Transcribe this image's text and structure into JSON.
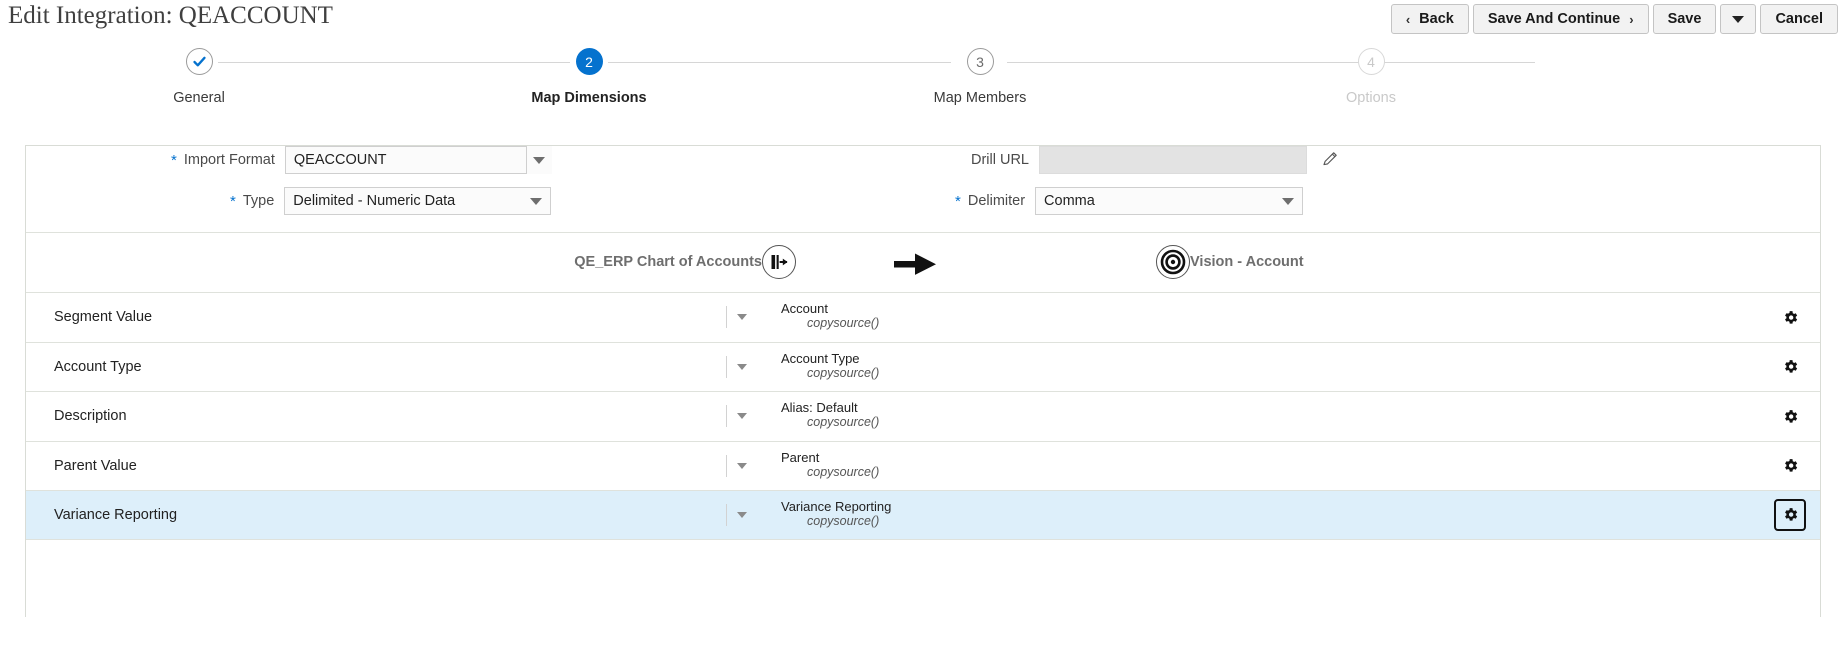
{
  "header": {
    "title": "Edit Integration: QEACCOUNT",
    "buttons": [
      {
        "name": "back",
        "label": "Back",
        "icon": "chevron-left-icon"
      },
      {
        "name": "save-and-continue",
        "label": "Save And Continue",
        "icon": "chevron-right-icon"
      },
      {
        "name": "save",
        "label": "Save",
        "icon": ""
      },
      {
        "name": "save-menu",
        "label": "",
        "icon": "caret-down-icon"
      },
      {
        "name": "cancel",
        "label": "Cancel",
        "icon": ""
      }
    ]
  },
  "train": {
    "steps": [
      {
        "number": "",
        "label": "General",
        "state": "done",
        "icon": "check-icon"
      },
      {
        "number": "2",
        "label": "Map Dimensions",
        "state": "current"
      },
      {
        "number": "3",
        "label": "Map Members",
        "state": "todo"
      },
      {
        "number": "4",
        "label": "Options",
        "state": "disabled"
      }
    ]
  },
  "form": {
    "import_format": {
      "label": "Import Format",
      "required": "*",
      "value": "QEACCOUNT",
      "placeholder": ""
    },
    "type": {
      "label": "Type",
      "required": "*",
      "value": "Delimited - Numeric Data",
      "placeholder": ""
    },
    "drill_url": {
      "label": "Drill URL",
      "required": "",
      "value": "",
      "placeholder": "",
      "edit_icon": "pencil-icon"
    },
    "delimiter": {
      "label": "Delimiter",
      "required": "*",
      "value": "Comma",
      "placeholder": ""
    }
  },
  "mapping": {
    "source_caption": "QE_ERP Chart of Accounts",
    "source_icon": "source-flow-icon",
    "arrow_icon": "arrow-right-icon",
    "target_caption": "Vision - Account",
    "target_icon": "target-bullseye-icon",
    "rows": [
      {
        "source": "Segment Value",
        "target": "Account",
        "expression": "copysource()",
        "selected": false,
        "gear_focused": false
      },
      {
        "source": "Account Type",
        "target": "Account Type",
        "expression": "copysource()",
        "selected": false,
        "gear_focused": false
      },
      {
        "source": "Description",
        "target": "Alias: Default",
        "expression": "copysource()",
        "selected": false,
        "gear_focused": false
      },
      {
        "source": "Parent Value",
        "target": "Parent",
        "expression": "copysource()",
        "selected": false,
        "gear_focused": false
      },
      {
        "source": "Variance Reporting",
        "target": "Variance Reporting",
        "expression": "copysource()",
        "selected": true,
        "gear_focused": true
      }
    ]
  },
  "colors": {
    "accent": "#0572ce",
    "selected_row": "#ddeffa",
    "border": "#dfe2dc",
    "disabled_text": "#c9c9c9"
  }
}
